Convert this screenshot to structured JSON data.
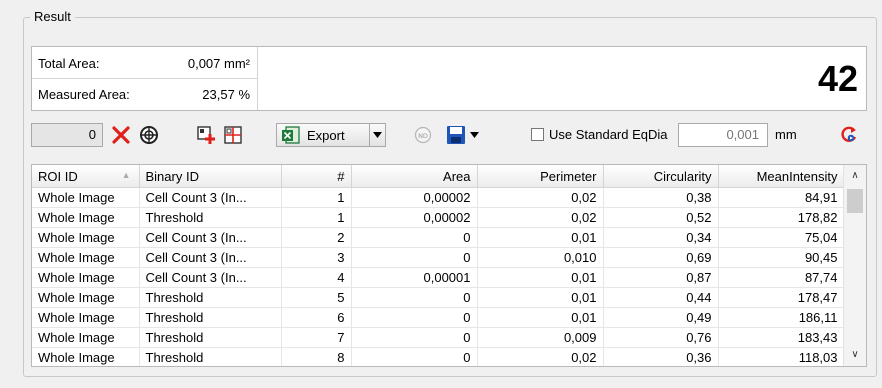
{
  "group": {
    "title": "Result"
  },
  "summary": {
    "total_area_label": "Total Area:",
    "total_area_value": "0,007 mm²",
    "measured_area_label": "Measured Area:",
    "measured_area_value": "23,57 %",
    "count": "42"
  },
  "toolbar": {
    "counter_value": "0",
    "export_label": "Export",
    "use_standard_eqdia_label": "Use Standard EqDia",
    "use_standard_eqdia_checked": false,
    "eqdia_value": "0,001",
    "eqdia_unit": "mm",
    "icons": [
      "delete-icon",
      "target-icon",
      "add-roi-icon",
      "grid-icon",
      "excel-export-icon",
      "nd-icon",
      "save-icon",
      "refresh-icon"
    ],
    "colors": {
      "delete": "#e0201b",
      "save": "#1f56b8",
      "excel": "#1d7a3c"
    }
  },
  "table": {
    "columns": [
      "ROI ID",
      "Binary ID",
      "#",
      "Area",
      "Perimeter",
      "Circularity",
      "MeanIntensity"
    ],
    "rows": [
      [
        "Whole Image",
        "Cell Count 3 (In...",
        "1",
        "0,00002",
        "0,02",
        "0,38",
        "84,91"
      ],
      [
        "Whole Image",
        "Threshold",
        "1",
        "0,00002",
        "0,02",
        "0,52",
        "178,82"
      ],
      [
        "Whole Image",
        "Cell Count 3 (In...",
        "2",
        "0",
        "0,01",
        "0,34",
        "75,04"
      ],
      [
        "Whole Image",
        "Cell Count 3 (In...",
        "3",
        "0",
        "0,010",
        "0,69",
        "90,45"
      ],
      [
        "Whole Image",
        "Cell Count 3 (In...",
        "4",
        "0,00001",
        "0,01",
        "0,87",
        "87,74"
      ],
      [
        "Whole Image",
        "Threshold",
        "5",
        "0",
        "0,01",
        "0,44",
        "178,47"
      ],
      [
        "Whole Image",
        "Threshold",
        "6",
        "0",
        "0,01",
        "0,49",
        "186,11"
      ],
      [
        "Whole Image",
        "Threshold",
        "7",
        "0",
        "0,009",
        "0,76",
        "183,43"
      ],
      [
        "Whole Image",
        "Threshold",
        "8",
        "0",
        "0,02",
        "0,36",
        "118,03"
      ]
    ]
  }
}
